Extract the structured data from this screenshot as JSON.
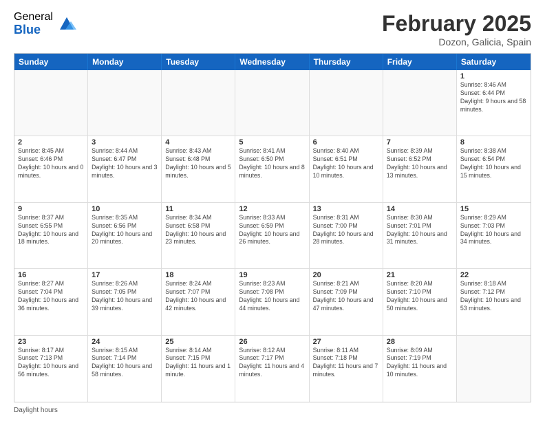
{
  "logo": {
    "general": "General",
    "blue": "Blue"
  },
  "title": {
    "month": "February 2025",
    "location": "Dozon, Galicia, Spain"
  },
  "header_days": [
    "Sunday",
    "Monday",
    "Tuesday",
    "Wednesday",
    "Thursday",
    "Friday",
    "Saturday"
  ],
  "weeks": [
    [
      {
        "day": "",
        "info": ""
      },
      {
        "day": "",
        "info": ""
      },
      {
        "day": "",
        "info": ""
      },
      {
        "day": "",
        "info": ""
      },
      {
        "day": "",
        "info": ""
      },
      {
        "day": "",
        "info": ""
      },
      {
        "day": "1",
        "info": "Sunrise: 8:46 AM\nSunset: 6:44 PM\nDaylight: 9 hours and 58 minutes."
      }
    ],
    [
      {
        "day": "2",
        "info": "Sunrise: 8:45 AM\nSunset: 6:46 PM\nDaylight: 10 hours and 0 minutes."
      },
      {
        "day": "3",
        "info": "Sunrise: 8:44 AM\nSunset: 6:47 PM\nDaylight: 10 hours and 3 minutes."
      },
      {
        "day": "4",
        "info": "Sunrise: 8:43 AM\nSunset: 6:48 PM\nDaylight: 10 hours and 5 minutes."
      },
      {
        "day": "5",
        "info": "Sunrise: 8:41 AM\nSunset: 6:50 PM\nDaylight: 10 hours and 8 minutes."
      },
      {
        "day": "6",
        "info": "Sunrise: 8:40 AM\nSunset: 6:51 PM\nDaylight: 10 hours and 10 minutes."
      },
      {
        "day": "7",
        "info": "Sunrise: 8:39 AM\nSunset: 6:52 PM\nDaylight: 10 hours and 13 minutes."
      },
      {
        "day": "8",
        "info": "Sunrise: 8:38 AM\nSunset: 6:54 PM\nDaylight: 10 hours and 15 minutes."
      }
    ],
    [
      {
        "day": "9",
        "info": "Sunrise: 8:37 AM\nSunset: 6:55 PM\nDaylight: 10 hours and 18 minutes."
      },
      {
        "day": "10",
        "info": "Sunrise: 8:35 AM\nSunset: 6:56 PM\nDaylight: 10 hours and 20 minutes."
      },
      {
        "day": "11",
        "info": "Sunrise: 8:34 AM\nSunset: 6:58 PM\nDaylight: 10 hours and 23 minutes."
      },
      {
        "day": "12",
        "info": "Sunrise: 8:33 AM\nSunset: 6:59 PM\nDaylight: 10 hours and 26 minutes."
      },
      {
        "day": "13",
        "info": "Sunrise: 8:31 AM\nSunset: 7:00 PM\nDaylight: 10 hours and 28 minutes."
      },
      {
        "day": "14",
        "info": "Sunrise: 8:30 AM\nSunset: 7:01 PM\nDaylight: 10 hours and 31 minutes."
      },
      {
        "day": "15",
        "info": "Sunrise: 8:29 AM\nSunset: 7:03 PM\nDaylight: 10 hours and 34 minutes."
      }
    ],
    [
      {
        "day": "16",
        "info": "Sunrise: 8:27 AM\nSunset: 7:04 PM\nDaylight: 10 hours and 36 minutes."
      },
      {
        "day": "17",
        "info": "Sunrise: 8:26 AM\nSunset: 7:05 PM\nDaylight: 10 hours and 39 minutes."
      },
      {
        "day": "18",
        "info": "Sunrise: 8:24 AM\nSunset: 7:07 PM\nDaylight: 10 hours and 42 minutes."
      },
      {
        "day": "19",
        "info": "Sunrise: 8:23 AM\nSunset: 7:08 PM\nDaylight: 10 hours and 44 minutes."
      },
      {
        "day": "20",
        "info": "Sunrise: 8:21 AM\nSunset: 7:09 PM\nDaylight: 10 hours and 47 minutes."
      },
      {
        "day": "21",
        "info": "Sunrise: 8:20 AM\nSunset: 7:10 PM\nDaylight: 10 hours and 50 minutes."
      },
      {
        "day": "22",
        "info": "Sunrise: 8:18 AM\nSunset: 7:12 PM\nDaylight: 10 hours and 53 minutes."
      }
    ],
    [
      {
        "day": "23",
        "info": "Sunrise: 8:17 AM\nSunset: 7:13 PM\nDaylight: 10 hours and 56 minutes."
      },
      {
        "day": "24",
        "info": "Sunrise: 8:15 AM\nSunset: 7:14 PM\nDaylight: 10 hours and 58 minutes."
      },
      {
        "day": "25",
        "info": "Sunrise: 8:14 AM\nSunset: 7:15 PM\nDaylight: 11 hours and 1 minute."
      },
      {
        "day": "26",
        "info": "Sunrise: 8:12 AM\nSunset: 7:17 PM\nDaylight: 11 hours and 4 minutes."
      },
      {
        "day": "27",
        "info": "Sunrise: 8:11 AM\nSunset: 7:18 PM\nDaylight: 11 hours and 7 minutes."
      },
      {
        "day": "28",
        "info": "Sunrise: 8:09 AM\nSunset: 7:19 PM\nDaylight: 11 hours and 10 minutes."
      },
      {
        "day": "",
        "info": ""
      }
    ]
  ],
  "footer": {
    "daylight_label": "Daylight hours"
  }
}
